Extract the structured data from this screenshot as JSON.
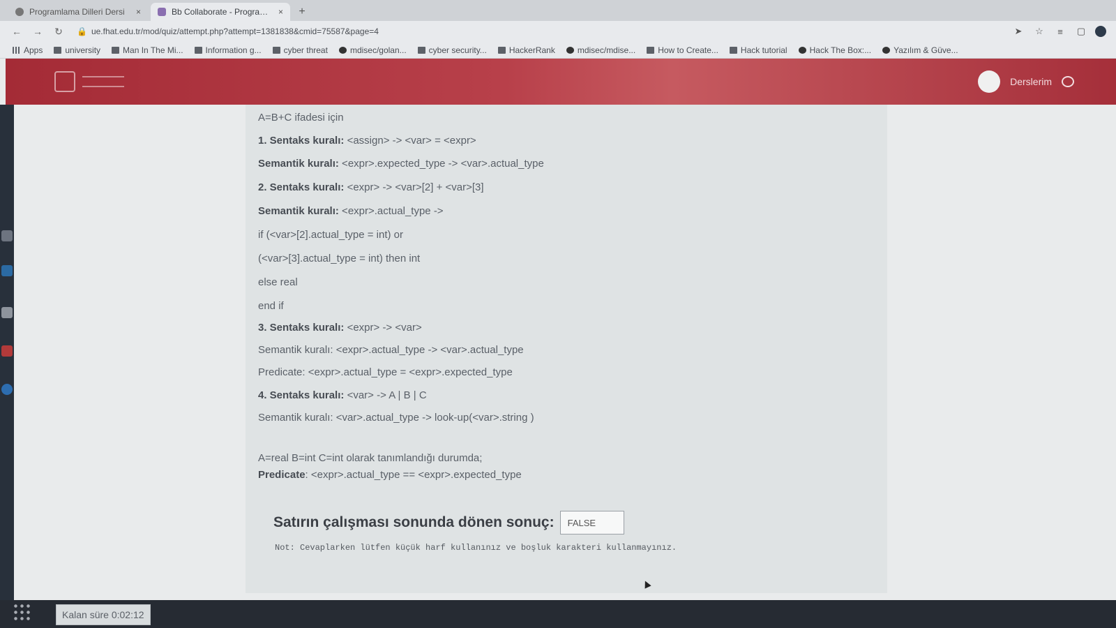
{
  "browser": {
    "tabs": [
      {
        "title": "Programlama Dilleri Dersi",
        "close": "×"
      },
      {
        "title": "Bb Collaborate - Program...",
        "close": "×"
      }
    ],
    "new_tab": "+",
    "url": "ue.fhat.edu.tr/mod/quiz/attempt.php?attempt=1381838&cmid=75587&page=4",
    "bookmarks": [
      "Apps",
      "university",
      "Man In The Mi...",
      "Information g...",
      "cyber threat",
      "mdisec/golan...",
      "cyber security...",
      "HackerRank",
      "mdisec/mdise...",
      "How to Create...",
      "Hack tutorial",
      "Hack The Box:...",
      "Yazılım & Güve..."
    ]
  },
  "header": {
    "user_menu": "Derslerim"
  },
  "question": {
    "intro": "A=B+C ifadesi için",
    "lines": [
      {
        "bold": "1. Sentaks kuralı:",
        "text": " <assign> -> <var> = <expr>"
      },
      {
        "bold": "Semantik kuralı:",
        "text": " <expr>.expected_type -> <var>.actual_type"
      },
      {
        "bold": "2. Sentaks kuralı:",
        "text": " <expr> -> <var>[2] + <var>[3]"
      },
      {
        "bold": "Semantik kuralı:",
        "text": " <expr>.actual_type ->"
      },
      {
        "bold": "",
        "text": "if (<var>[2].actual_type = int) or"
      },
      {
        "bold": "",
        "text": "(<var>[3].actual_type = int) then int"
      },
      {
        "bold": "",
        "text": "else real"
      },
      {
        "bold": "",
        "text": "end if"
      },
      {
        "bold": "3. Sentaks kuralı:",
        "text": " <expr> -> <var>"
      },
      {
        "bold": "",
        "text": "Semantik kuralı: <expr>.actual_type -> <var>.actual_type"
      },
      {
        "bold": "",
        "text": "Predicate: <expr>.actual_type = <expr>.expected_type"
      },
      {
        "bold": "4. Sentaks kuralı:",
        "text": " <var> -> A | B | C"
      },
      {
        "bold": "",
        "text": "Semantik kuralı: <var>.actual_type -> look-up(<var>.string )"
      },
      {
        "bold": "",
        "text": "A=real B=int C=int olarak tanımlandığı durumda;"
      },
      {
        "bold": "Predicate",
        "text": ": <expr>.actual_type == <expr>.expected_type"
      }
    ],
    "answer_label": "Satırın çalışması sonunda dönen sonuç:",
    "answer_value": "FALSE",
    "note": "Not: Cevaplarken lütfen küçük harf kullanınız ve boşluk karakteri kullanmayınız."
  },
  "footer": {
    "timer": "Kalan süre 0:02:12"
  }
}
